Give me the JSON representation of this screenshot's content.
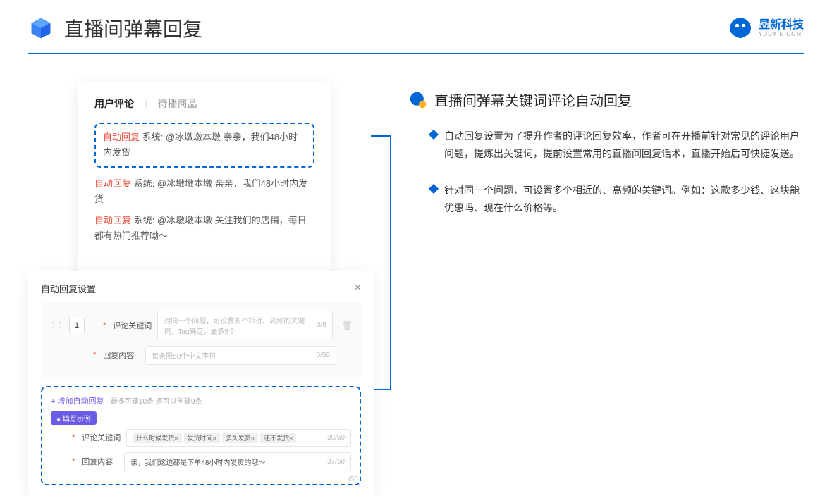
{
  "header": {
    "title": "直播间弹幕回复"
  },
  "brand": {
    "name": "昱新科技",
    "sub": "YUUXIN.COM"
  },
  "comments": {
    "tab_active": "用户评论",
    "tab_inactive": "待播商品",
    "row1": {
      "tag": "自动回复",
      "text": " 系统: @冰墩墩本墩 亲亲，我们48小时内发货"
    },
    "row2": {
      "tag": "自动回复",
      "text": " 系统: @冰墩墩本墩 亲亲，我们48小时内发货"
    },
    "row3": {
      "tag": "自动回复",
      "text": " 系统: @冰墩墩本墩 关注我们的店铺，每日都有热门推荐呦～"
    }
  },
  "settings": {
    "title": "自动回复设置",
    "index": "1",
    "kw_label": "评论关键词",
    "kw_placeholder": "对同一个问题，可设置多个相近、高频的关键词，Tag确定，最多5个",
    "kw_counter": "0/5",
    "content_label": "回复内容",
    "content_placeholder": "每条限50个中文字符",
    "content_counter": "0/50",
    "add_text": "+ 增加自动回复",
    "add_hint": "最多可建10条 还可以创建9条",
    "badge": "● 填写示例",
    "ex_kw_label": "评论关键词",
    "ex_tags": [
      "什么时候发货×",
      "发货时间×",
      "多久发货×",
      "还不发货×"
    ],
    "ex_kw_counter": "20/50",
    "ex_content_label": "回复内容",
    "ex_content_value": "亲，我们这边都是下单48小时内发货的哦～",
    "ex_content_counter": "37/50",
    "extra_counter": "/50"
  },
  "section": {
    "title": "直播间弹幕关键词评论自动回复",
    "bullet1": "自动回复设置为了提升作者的评论回复效率，作者可在开播前针对常见的评论用户问题，提炼出关键词，提前设置常用的直播间回复话术，直播开始后可快捷发送。",
    "bullet2": "针对同一个问题，可设置多个相近的、高频的关键词。例如：这款多少钱、这块能优惠吗、现在什么价格等。"
  }
}
